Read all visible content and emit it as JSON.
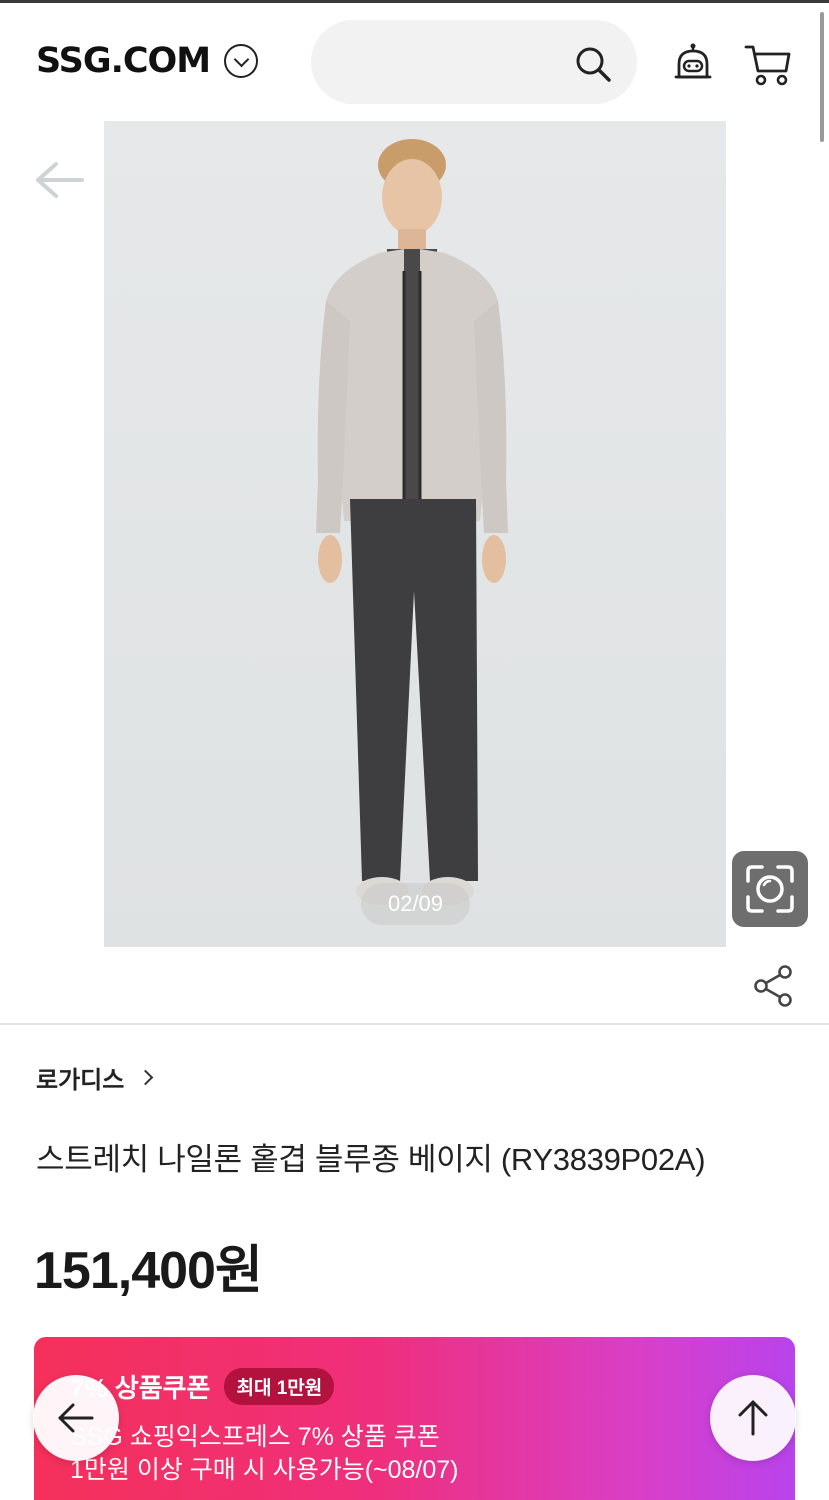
{
  "header": {
    "logo": "SSG.COM",
    "logo_menu_icon": "chevron-down-circle-icon",
    "search_icon": "search-icon",
    "bell_icon": "bell-icon",
    "cart_icon": "cart-icon"
  },
  "gallery": {
    "back_icon": "arrow-left-icon",
    "counter": "02/09",
    "lens_icon": "camera-lens-icon",
    "share_icon": "share-icon"
  },
  "product": {
    "brand": "로가디스",
    "title": "스트레치 나일론 홑겹 블루종 베이지 (RY3839P02A)",
    "price": "151,400원"
  },
  "coupon": {
    "title": "7% 상품쿠폰",
    "badge": "최대 1만원",
    "line1": "SSG 쇼핑익스프레스 7% 상품 쿠폰",
    "line2": "1만원 이상 구매 시 사용가능(~08/07)",
    "gradient_start": "#f5305a",
    "gradient_end": "#b843ec"
  },
  "floating": {
    "back_icon": "arrow-left-icon",
    "top_icon": "arrow-up-icon"
  }
}
